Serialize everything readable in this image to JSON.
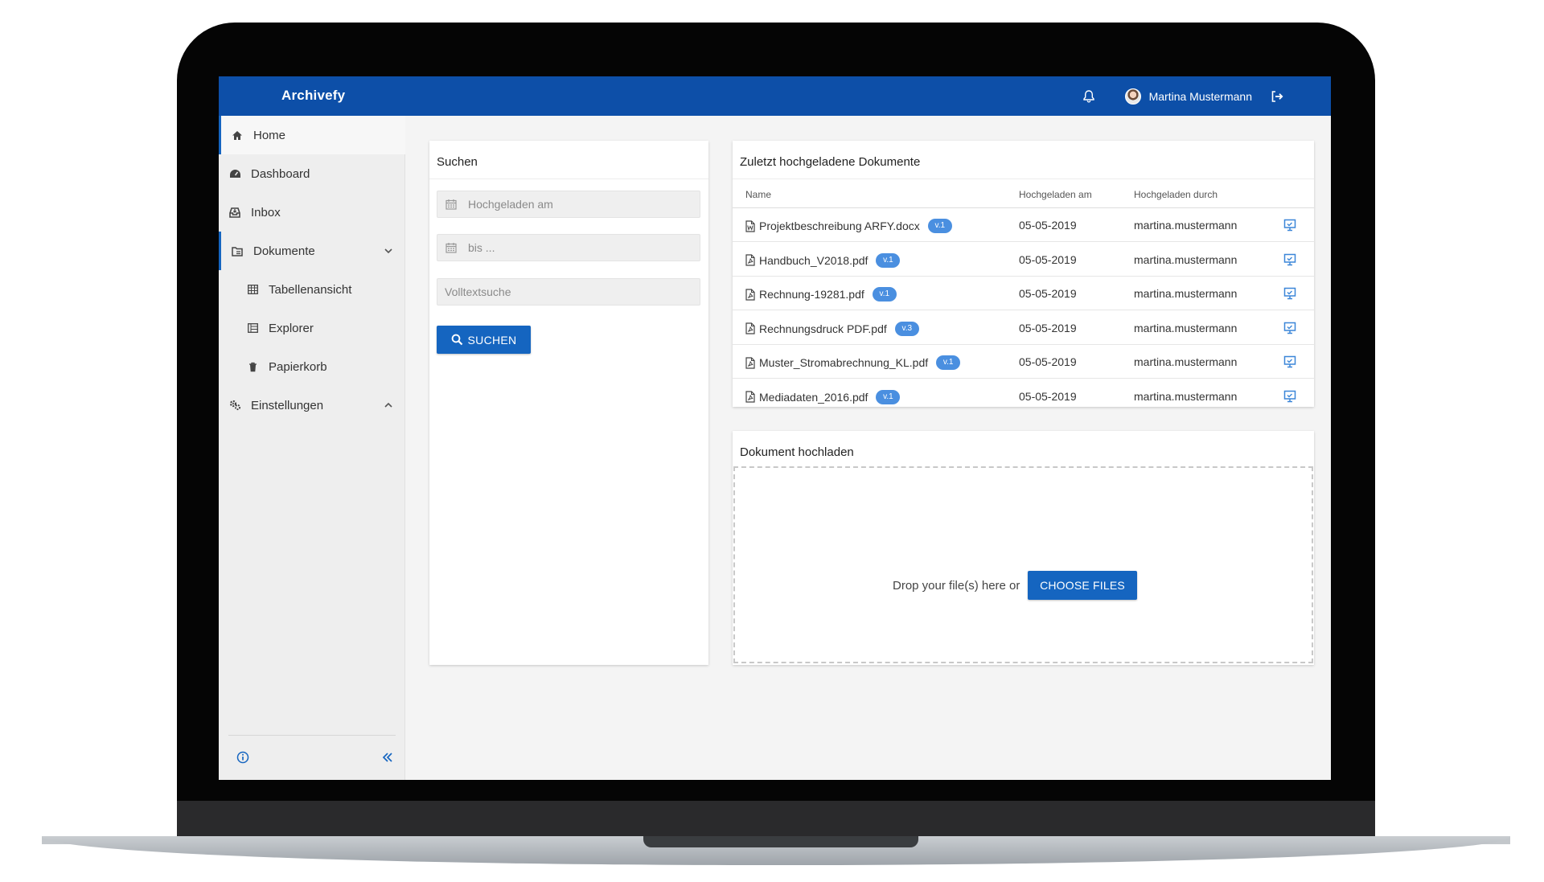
{
  "app": {
    "title": "Archivefy",
    "user_name": "Martina Mustermann",
    "accent_color": "#0d4fa8",
    "button_color": "#1565c0",
    "badge_color": "#4a8fe0"
  },
  "header": {
    "icons": [
      "bell-icon",
      "avatar",
      "logout-icon"
    ]
  },
  "sidebar": {
    "items": [
      {
        "label": "Home",
        "icon": "home-icon"
      },
      {
        "label": "Dashboard",
        "icon": "dashboard-icon"
      },
      {
        "label": "Inbox",
        "icon": "inbox-icon"
      },
      {
        "label": "Dokumente",
        "icon": "documents-icon",
        "expanded": true
      },
      {
        "label": "Tabellenansicht",
        "icon": "table-icon"
      },
      {
        "label": "Explorer",
        "icon": "explorer-icon"
      },
      {
        "label": "Papierkorb",
        "icon": "trash-icon"
      },
      {
        "label": "Einstellungen",
        "icon": "settings-icon",
        "expanded": false
      }
    ],
    "footer_icons": [
      "info-icon",
      "collapse-icon"
    ]
  },
  "search": {
    "title": "Suchen",
    "uploaded_on_placeholder": "Hochgeladen am",
    "to_placeholder": "bis ...",
    "fulltext_placeholder": "Volltextsuche",
    "button_label": "SUCHEN"
  },
  "recent": {
    "title": "Zuletzt hochgeladene Dokumente",
    "columns": [
      "Name",
      "Hochgeladen am",
      "Hochgeladen durch"
    ],
    "rows": [
      {
        "name": "Projektbeschreibung ARFY.docx",
        "version": "v.1",
        "date": "05-05-2019",
        "user": "martina.mustermann",
        "type": "word"
      },
      {
        "name": "Handbuch_V2018.pdf",
        "version": "v.1",
        "date": "05-05-2019",
        "user": "martina.mustermann",
        "type": "pdf"
      },
      {
        "name": "Rechnung-19281.pdf",
        "version": "v.1",
        "date": "05-05-2019",
        "user": "martina.mustermann",
        "type": "pdf"
      },
      {
        "name": "Rechnungsdruck PDF.pdf",
        "version": "v.3",
        "date": "05-05-2019",
        "user": "martina.mustermann",
        "type": "pdf"
      },
      {
        "name": "Muster_Stromabrechnung_KL.pdf",
        "version": "v.1",
        "date": "05-05-2019",
        "user": "martina.mustermann",
        "type": "pdf"
      },
      {
        "name": "Mediadaten_2016.pdf",
        "version": "v.1",
        "date": "05-05-2019",
        "user": "martina.mustermann",
        "type": "pdf"
      }
    ]
  },
  "upload": {
    "title": "Dokument hochladen",
    "drop_text": "Drop your file(s) here or",
    "button_label": "CHOOSE FILES"
  }
}
